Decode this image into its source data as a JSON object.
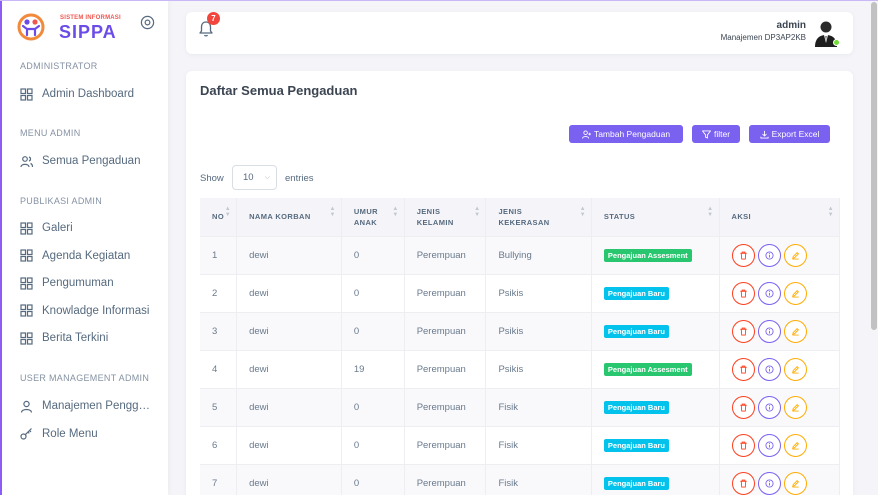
{
  "brand": {
    "small_text": "SISTEM INFORMASI",
    "name": "SIPPA"
  },
  "sidebar": {
    "sections": [
      {
        "title": "ADMINISTRATOR",
        "items": [
          {
            "label": "Admin Dashboard",
            "icon": "grid-icon"
          }
        ]
      },
      {
        "title": "MENU ADMIN",
        "items": [
          {
            "label": "Semua Pengaduan",
            "icon": "users-icon"
          }
        ]
      },
      {
        "title": "PUBLIKASI ADMIN",
        "items": [
          {
            "label": "Galeri",
            "icon": "grid-icon"
          },
          {
            "label": "Agenda Kegiatan",
            "icon": "grid-icon"
          },
          {
            "label": "Pengumuman",
            "icon": "grid-icon"
          },
          {
            "label": "Knowladge Informasi",
            "icon": "grid-icon"
          },
          {
            "label": "Berita Terkini",
            "icon": "grid-icon"
          }
        ]
      },
      {
        "title": "USER MANAGEMENT ADMIN",
        "items": [
          {
            "label": "Manajemen Pengguna",
            "icon": "user-icon"
          },
          {
            "label": "Role Menu",
            "icon": "key-icon"
          }
        ]
      }
    ]
  },
  "topbar": {
    "notification_count": "7",
    "user_name": "admin",
    "user_role": "Manajemen DP3AP2KB"
  },
  "main": {
    "title": "Daftar Semua Pengaduan",
    "buttons": {
      "add": "Tambah Pengaduan",
      "filter": "filter",
      "export": "Export Excel"
    },
    "show_label": "Show",
    "entries_value": "10",
    "entries_label": "entries",
    "columns": [
      "NO",
      "NAMA KORBAN",
      "UMUR ANAK",
      "JENIS KELAMIN",
      "JENIS KEKERASAN",
      "STATUS",
      "AKSI"
    ],
    "rows": [
      {
        "no": "1",
        "nama": "dewi",
        "umur": "0",
        "kelamin": "Perempuan",
        "kekerasan": "Bullying",
        "status": "Pengajuan Assesment",
        "status_type": "assesment"
      },
      {
        "no": "2",
        "nama": "dewi",
        "umur": "0",
        "kelamin": "Perempuan",
        "kekerasan": "Psikis",
        "status": "Pengajuan Baru",
        "status_type": "baru"
      },
      {
        "no": "3",
        "nama": "dewi",
        "umur": "0",
        "kelamin": "Perempuan",
        "kekerasan": "Psikis",
        "status": "Pengajuan Baru",
        "status_type": "baru"
      },
      {
        "no": "4",
        "nama": "dewi",
        "umur": "19",
        "kelamin": "Perempuan",
        "kekerasan": "Psikis",
        "status": "Pengajuan Assesment",
        "status_type": "assesment"
      },
      {
        "no": "5",
        "nama": "dewi",
        "umur": "0",
        "kelamin": "Perempuan",
        "kekerasan": "Fisik",
        "status": "Pengajuan Baru",
        "status_type": "baru"
      },
      {
        "no": "6",
        "nama": "dewi",
        "umur": "0",
        "kelamin": "Perempuan",
        "kekerasan": "Fisik",
        "status": "Pengajuan Baru",
        "status_type": "baru"
      },
      {
        "no": "7",
        "nama": "dewi",
        "umur": "0",
        "kelamin": "Perempuan",
        "kekerasan": "Fisik",
        "status": "Pengajuan Baru",
        "status_type": "baru"
      }
    ]
  },
  "colors": {
    "primary": "#7b61f0",
    "assesment": "#28c76f",
    "baru": "#03c3ec",
    "danger": "#ff3e1d",
    "warning": "#ffab00"
  }
}
